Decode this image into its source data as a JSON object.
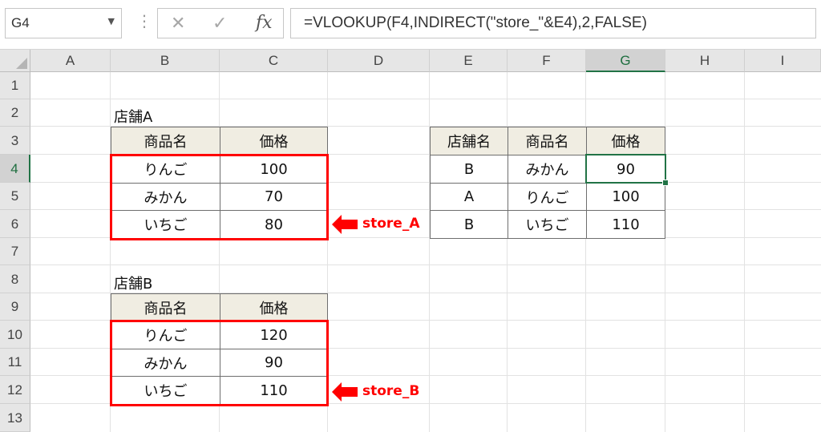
{
  "formula_bar": {
    "name_box": "G4",
    "name_box_dropdown": "▼",
    "separator": "⋮",
    "cancel": "✕",
    "enter": "✓",
    "fx": "fx",
    "formula": "=VLOOKUP(F4,INDIRECT(\"store_\"&E4),2,FALSE)"
  },
  "columns": [
    "A",
    "B",
    "C",
    "D",
    "E",
    "F",
    "G",
    "H",
    "I"
  ],
  "rows": [
    "1",
    "2",
    "3",
    "4",
    "5",
    "6",
    "7",
    "8",
    "9",
    "10",
    "11",
    "12",
    "13"
  ],
  "selected": {
    "column": "G",
    "row": "4"
  },
  "store_a": {
    "title": "店舗A",
    "headers": [
      "商品名",
      "価格"
    ],
    "rows": [
      [
        "りんご",
        "100"
      ],
      [
        "みかん",
        "70"
      ],
      [
        "いちご",
        "80"
      ]
    ],
    "callout": "store_A"
  },
  "store_b": {
    "title": "店舗B",
    "headers": [
      "商品名",
      "価格"
    ],
    "rows": [
      [
        "りんご",
        "120"
      ],
      [
        "みかん",
        "90"
      ],
      [
        "いちご",
        "110"
      ]
    ],
    "callout": "store_B"
  },
  "lookup_table": {
    "headers": [
      "店舗名",
      "商品名",
      "価格"
    ],
    "rows": [
      [
        "B",
        "みかん",
        "90"
      ],
      [
        "A",
        "りんご",
        "100"
      ],
      [
        "B",
        "いちご",
        "110"
      ]
    ]
  },
  "colors": {
    "highlight": "#ff0000",
    "selection": "#217346",
    "header_fill": "#f0ede2"
  }
}
